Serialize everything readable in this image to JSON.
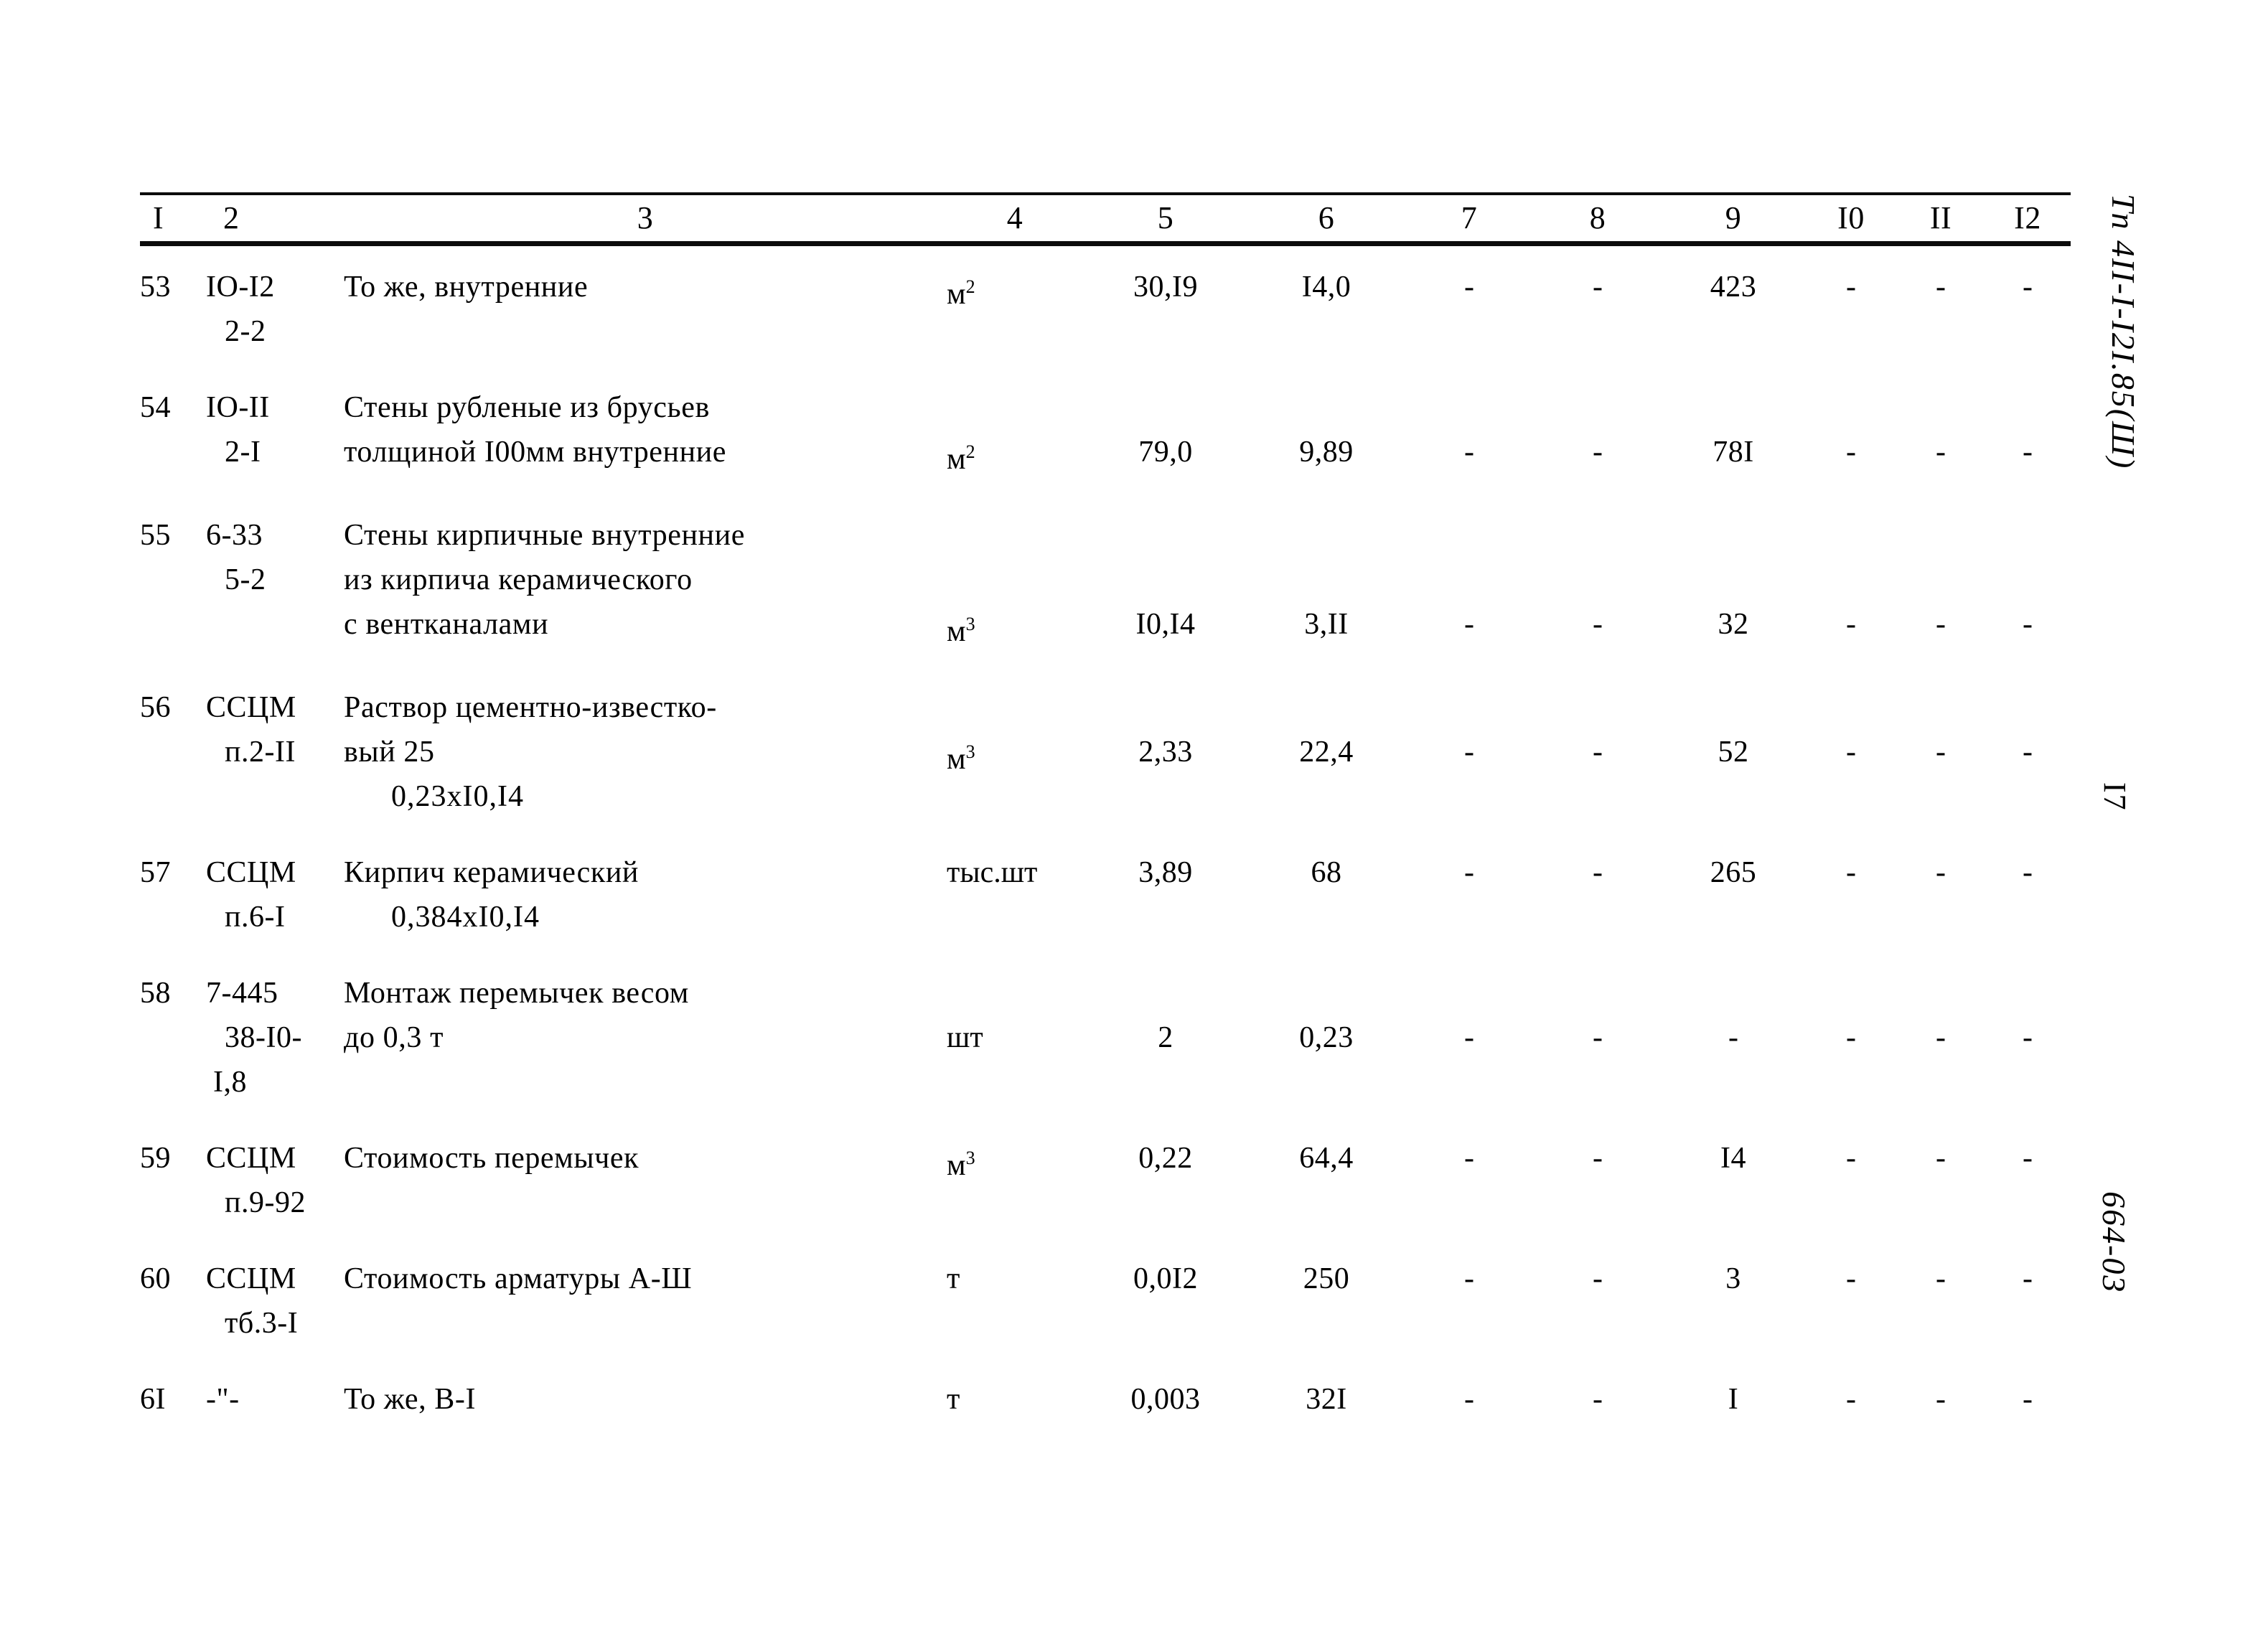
{
  "document": {
    "margin_code": "Тп 4II-I-I2I.85(Ш)",
    "page_number": "I7",
    "doc_number": "664-03"
  },
  "table": {
    "column_headers": [
      "I",
      "2",
      "3",
      "4",
      "5",
      "6",
      "7",
      "8",
      "9",
      "I0",
      "II",
      "I2"
    ],
    "rows": [
      {
        "num": "53",
        "code_lines": [
          "IO-I2",
          "2-2"
        ],
        "desc_lines": [
          "То же, внутренние"
        ],
        "unit_base": "м",
        "unit_sup": "2",
        "c5": "30,I9",
        "c6": "I4,0",
        "c7": "-",
        "c8": "-",
        "c9": "423",
        "c10": "-",
        "c11": "-",
        "c12": "-"
      },
      {
        "num": "54",
        "code_lines": [
          "IO-II",
          "2-I"
        ],
        "desc_lines": [
          "Стены рубленые из брусьев",
          "толщиной I00мм внутренние"
        ],
        "unit_base": "м",
        "unit_sup": "2",
        "c5": "79,0",
        "c6": "9,89",
        "c7": "-",
        "c8": "-",
        "c9": "78I",
        "c10": "-",
        "c11": "-",
        "c12": "-"
      },
      {
        "num": "55",
        "code_lines": [
          "6-33",
          "5-2"
        ],
        "desc_lines": [
          "Стены кирпичные внутренние",
          "из кирпича керамического",
          "с вентканалами"
        ],
        "unit_base": "м",
        "unit_sup": "3",
        "c5": "I0,I4",
        "c6": "3,II",
        "c7": "-",
        "c8": "-",
        "c9": "32",
        "c10": "-",
        "c11": "-",
        "c12": "-"
      },
      {
        "num": "56",
        "code_lines": [
          "ССЦМ",
          "п.2-II"
        ],
        "desc_lines": [
          "Раствор цементно-известко-",
          "вый 25"
        ],
        "desc_indent": "0,23xI0,I4",
        "unit_base": "м",
        "unit_sup": "3",
        "c5": "2,33",
        "c6": "22,4",
        "c7": "-",
        "c8": "-",
        "c9": "52",
        "c10": "-",
        "c11": "-",
        "c12": "-"
      },
      {
        "num": "57",
        "code_lines": [
          "ССЦМ",
          "п.6-I"
        ],
        "desc_lines": [
          "Кирпич керамический"
        ],
        "desc_indent": "0,384xI0,I4",
        "unit_base": "тыс.шт",
        "unit_sup": "",
        "c5": "3,89",
        "c6": "68",
        "c7": "-",
        "c8": "-",
        "c9": "265",
        "c10": "-",
        "c11": "-",
        "c12": "-"
      },
      {
        "num": "58",
        "code_lines": [
          "7-445",
          "38-I0-",
          "I,8"
        ],
        "desc_lines": [
          "Монтаж перемычек весом",
          "до 0,3 т"
        ],
        "unit_base": "шт",
        "unit_sup": "",
        "c5": "2",
        "c6": "0,23",
        "c7": "-",
        "c8": "-",
        "c9": "-",
        "c10": "-",
        "c11": "-",
        "c12": "-"
      },
      {
        "num": "59",
        "code_lines": [
          "ССЦМ",
          "п.9-92"
        ],
        "desc_lines": [
          "Стоимость перемычек"
        ],
        "unit_base": "м",
        "unit_sup": "3",
        "c5": "0,22",
        "c6": "64,4",
        "c7": "-",
        "c8": "-",
        "c9": "I4",
        "c10": "-",
        "c11": "-",
        "c12": "-"
      },
      {
        "num": "60",
        "code_lines": [
          "ССЦМ",
          "тб.3-I"
        ],
        "desc_lines": [
          "Стоимость арматуры А-Ш"
        ],
        "unit_base": "т",
        "unit_sup": "",
        "c5": "0,0I2",
        "c6": "250",
        "c7": "-",
        "c8": "-",
        "c9": "3",
        "c10": "-",
        "c11": "-",
        "c12": "-"
      },
      {
        "num": "6I",
        "code_lines": [
          "-\"-"
        ],
        "desc_lines": [
          "То же, В-I"
        ],
        "unit_base": "т",
        "unit_sup": "",
        "c5": "0,003",
        "c6": "32I",
        "c7": "-",
        "c8": "-",
        "c9": "I",
        "c10": "-",
        "c11": "-",
        "c12": "-"
      }
    ]
  }
}
